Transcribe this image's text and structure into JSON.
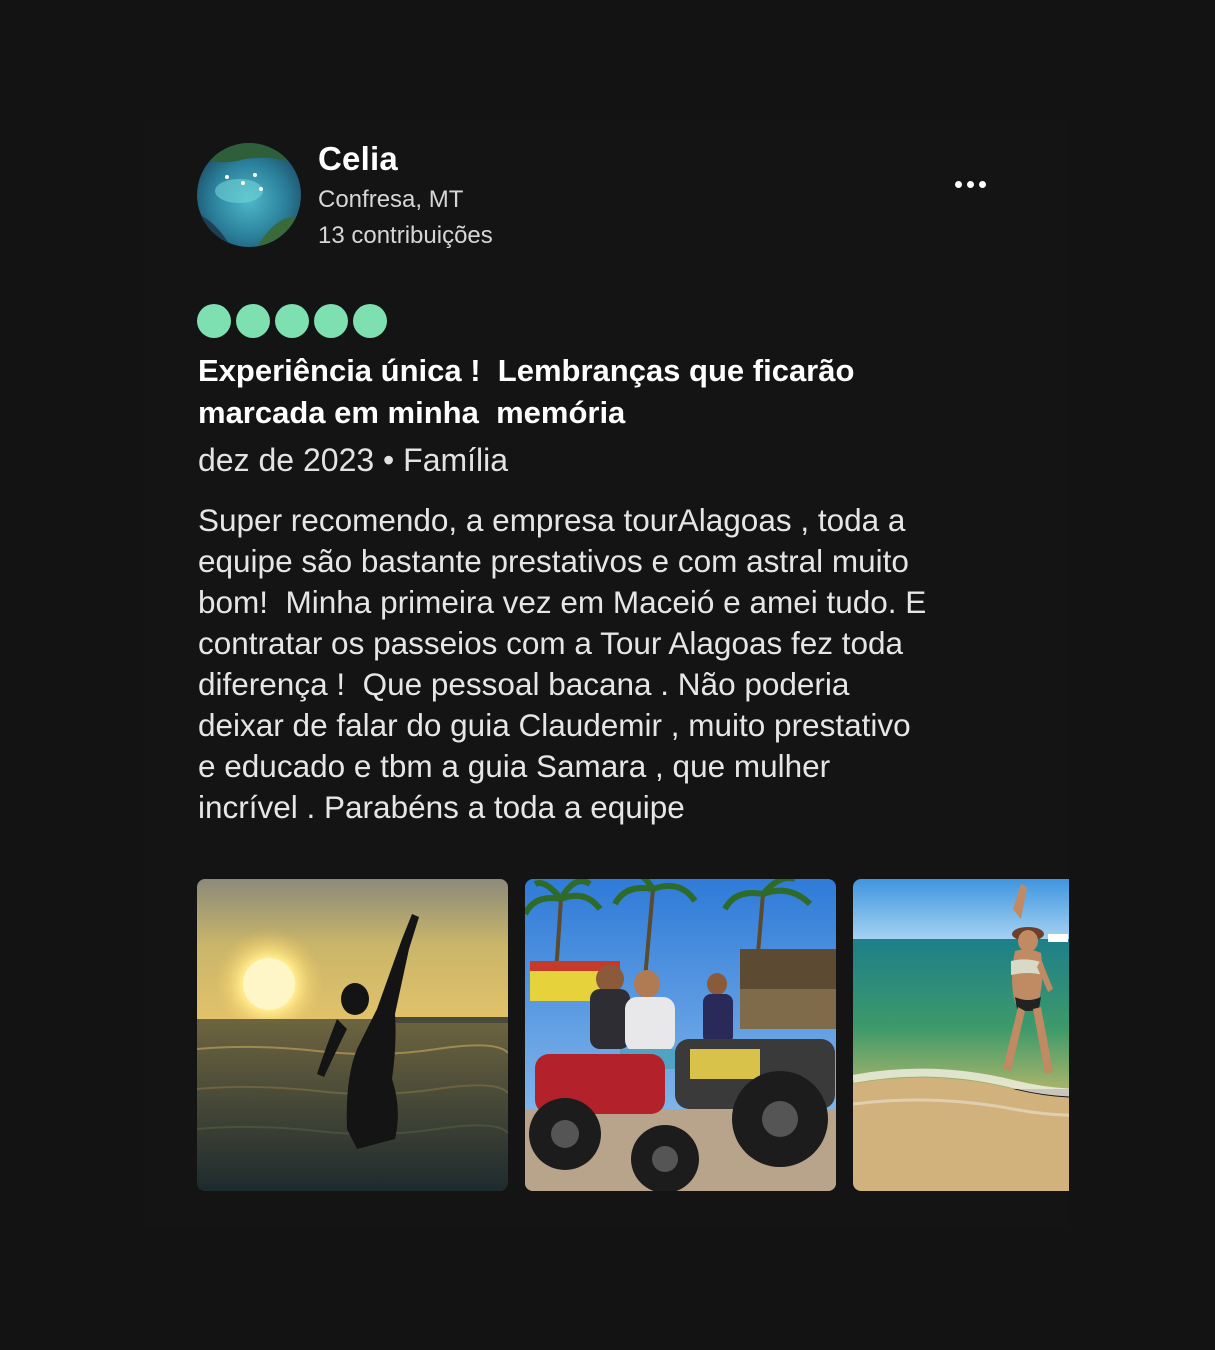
{
  "reviewer": {
    "name": "Celia",
    "location": "Confresa, MT",
    "contributions": "13 contribuições",
    "avatar_icon": "avatar-photo"
  },
  "menu": {
    "icon": "more-options-icon"
  },
  "rating": {
    "value": 5,
    "max": 5,
    "color": "#7ee0b0"
  },
  "review": {
    "title": "Experiência única !  Lembranças que ficarão\nmarcada em minha  memória",
    "meta": "dez de 2023 • Família",
    "body": "Super recomendo, a empresa tourAlagoas , toda a\nequipe são bastante prestativos e com astral muito\nbom!  Minha primeira vez em Maceió e amei tudo. E\ncontratar os passeios com a Tour Alagoas fez toda\ndiferença !  Que pessoal bacana . Não poderia\ndeixar de falar do guia Claudemir , muito prestativo\ne educado e tbm a guia Samara , que mulher\nincrível . Parabéns a toda a equipe"
  },
  "photos": [
    {
      "icon": "sunset-sea-photo"
    },
    {
      "icon": "atv-beach-photo"
    },
    {
      "icon": "beach-shore-photo"
    }
  ]
}
